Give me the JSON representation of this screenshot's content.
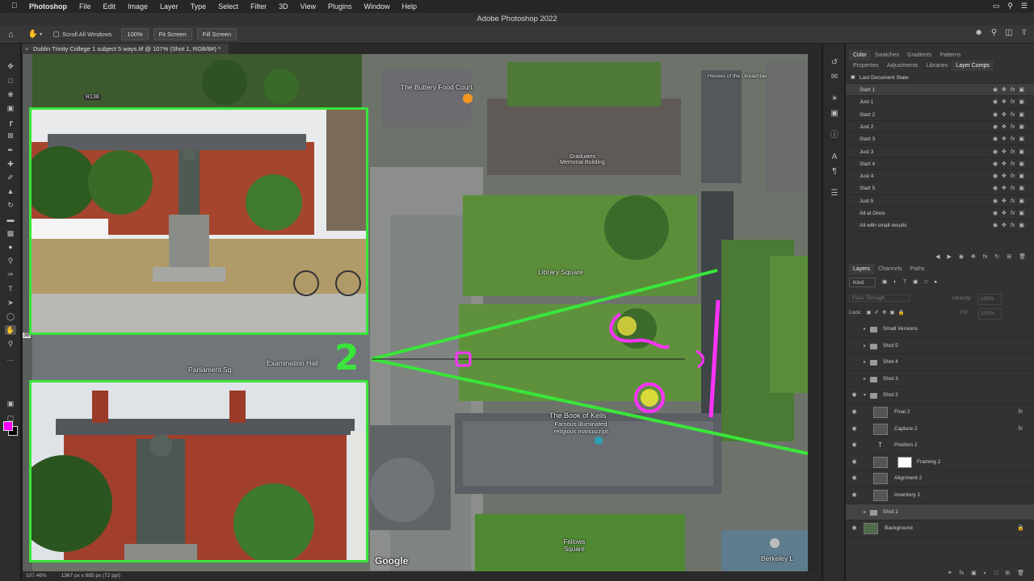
{
  "menubar": {
    "items": [
      "Photoshop",
      "File",
      "Edit",
      "Image",
      "Layer",
      "Type",
      "Select",
      "Filter",
      "3D",
      "View",
      "Plugins",
      "Window",
      "Help"
    ]
  },
  "window": {
    "title": "Adobe Photoshop 2022"
  },
  "options": {
    "scroll_all": "Scroll All Windows",
    "zoom_100": "100%",
    "fit_screen": "Fit Screen",
    "fill_screen": "Fill Screen"
  },
  "document": {
    "tab": "Dublin Trinity College 1 subject 5 ways.tif @ 107% (Shot 1, RGB/8#) *",
    "zoom": "107.46%",
    "dimensions": "1367 px x 885 px (72 ppi)"
  },
  "map": {
    "road_label": "R138",
    "buttery": "The Buttery Food Court",
    "graduates": "Graduates Memorial Building",
    "library_square": "Library Square",
    "exam_hall": "Examination Hall",
    "parliament": "Parliament Sq",
    "book_of_kells_title": "The Book of Kells",
    "book_of_kells_sub": "Famous illuminated religious manuscript",
    "fellows": "Fellows Square",
    "berkeley": "Berkeley L",
    "houses": "Houses of the Oireachtas",
    "google": "Google",
    "shot_number": "2",
    "ruler_mark": "38"
  },
  "colors": {
    "accent_green": "#39e639",
    "annotation_magenta": "#ff33ff",
    "foreground": "#ff00ff",
    "background": "#000000"
  },
  "panels": {
    "top_tabs_row1": [
      "Color",
      "Swatches",
      "Gradients",
      "Patterns"
    ],
    "top_tabs_row2": [
      "Properties",
      "Adjustments",
      "Libraries",
      "Layer Comps"
    ],
    "last_state": "Last Document State",
    "layer_comps": [
      "Start 1",
      "Just 1",
      "Start 2",
      "Just 2",
      "Start 3",
      "Just 3",
      "Start 4",
      "Just 4",
      "Start 5",
      "Just 5",
      "All at Once",
      "All with small results"
    ],
    "layers_tabs": [
      "Layers",
      "Channels",
      "Paths"
    ],
    "kind": "Kind",
    "blend": "Pass Through",
    "opacity_label": "Opacity:",
    "opacity_value": "100%",
    "lock_label": "Lock:",
    "fill_label": "Fill:",
    "fill_value": "100%",
    "layers": [
      {
        "name": "Small Versions",
        "type": "group"
      },
      {
        "name": "Shot 5",
        "type": "group"
      },
      {
        "name": "Shot 4",
        "type": "group"
      },
      {
        "name": "Shot 3",
        "type": "group"
      },
      {
        "name": "Shot 2",
        "type": "group-open"
      },
      {
        "name": "Final 2",
        "type": "layer",
        "fx": "fx"
      },
      {
        "name": "Capture 2",
        "type": "layer",
        "fx": "fx"
      },
      {
        "name": "Position 2",
        "type": "text"
      },
      {
        "name": "Framing 2",
        "type": "layer-mask"
      },
      {
        "name": "Alignment 2",
        "type": "layer"
      },
      {
        "name": "Inventory 2",
        "type": "layer"
      },
      {
        "name": "Shot 1",
        "type": "group"
      },
      {
        "name": "Background",
        "type": "background"
      }
    ]
  }
}
